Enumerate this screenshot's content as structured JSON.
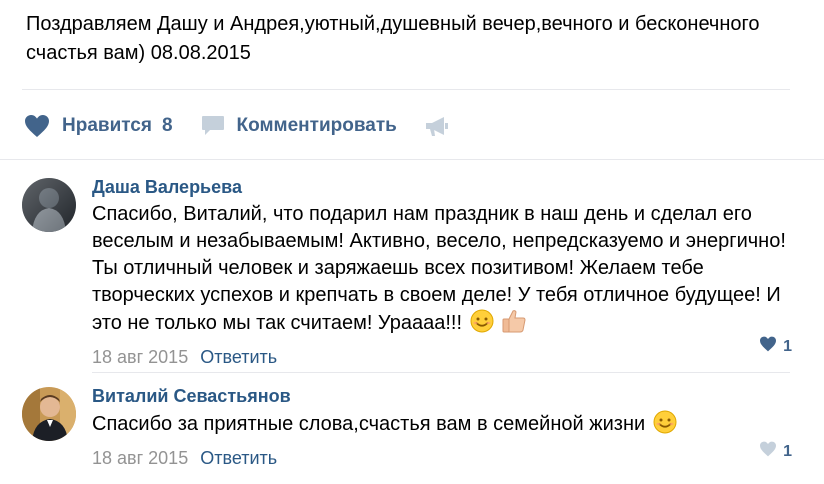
{
  "post": {
    "text": "Поздравляем Дашу и Андрея,уютный,душевный вечер,вечного и бесконечного счастья вам) 08.08.2015"
  },
  "actions": {
    "like_label": "Нравится",
    "like_count": "8",
    "comment_label": "Комментировать",
    "share_icon": "megaphone-icon",
    "like_icon": "heart-icon",
    "comment_icon": "speech-bubble-icon"
  },
  "comments": [
    {
      "author": "Даша Валерьева",
      "text": "Спасибо, Виталий, что подарил нам праздник в наш день и сделал его веселым и незабываемым! Активно, весело, непредсказуемо и энергично! Ты отличный человек и заряжаешь всех позитивом! Желаем тебе творческих успехов и крепчать в своем деле! У тебя отличное будущее! И это не только мы так считаем! Ураааа!!!",
      "emojis": [
        "smiling-face-emoji",
        "thumbs-up-emoji"
      ],
      "date": "18 авг 2015",
      "reply_label": "Ответить",
      "likes": "1",
      "liked": true
    },
    {
      "author": "Виталий Севастьянов",
      "text": "Спасибо за приятные слова,счастья вам в семейной жизни",
      "emojis": [
        "smiling-face-emoji"
      ],
      "date": "18 авг 2015",
      "reply_label": "Ответить",
      "likes": "1",
      "liked": false
    }
  ],
  "colors": {
    "link": "#2a5885",
    "action": "#42648b",
    "meta": "#939393",
    "divider": "#e7e8ec",
    "heart_active": "#42648b",
    "heart_inactive": "#c5d0db"
  }
}
